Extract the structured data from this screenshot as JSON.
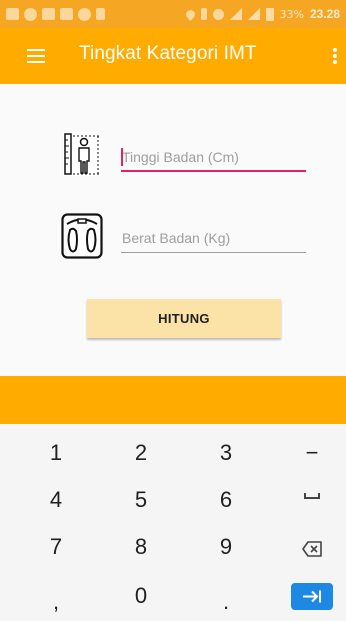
{
  "status_bar": {
    "battery_text": "33%",
    "time": "23.28",
    "icons": [
      "message-icon",
      "message-icon",
      "image-icon",
      "briefcase-icon",
      "chat-icon",
      "hourglass-icon",
      "location-icon",
      "bluetooth-icon",
      "alarm-icon",
      "signal-icon",
      "signal-icon",
      "battery-icon"
    ]
  },
  "app_bar": {
    "title": "Tingkat Kategori IMT",
    "left_icon": "menu-icon",
    "right_icon": "overflow-menu-icon",
    "color": "#ffab00"
  },
  "form": {
    "height_icon": "height-measure-icon",
    "height_placeholder": "Tinggi Badan (Cm)",
    "weight_icon": "weighing-scale-icon",
    "weight_placeholder": "Berat Badan (Kg)",
    "button_label": "HITUNG",
    "focus_color": "#e91e63",
    "button_color": "#fbe3a8"
  },
  "keyboard": {
    "rows": [
      [
        "1",
        "2",
        "3",
        "−"
      ],
      [
        "4",
        "5",
        "6",
        "space-icon"
      ],
      [
        "7",
        "8",
        "9",
        "backspace-icon"
      ],
      [
        ",",
        "0",
        ".",
        "next-icon"
      ]
    ],
    "action_color": "#1e88e5"
  }
}
